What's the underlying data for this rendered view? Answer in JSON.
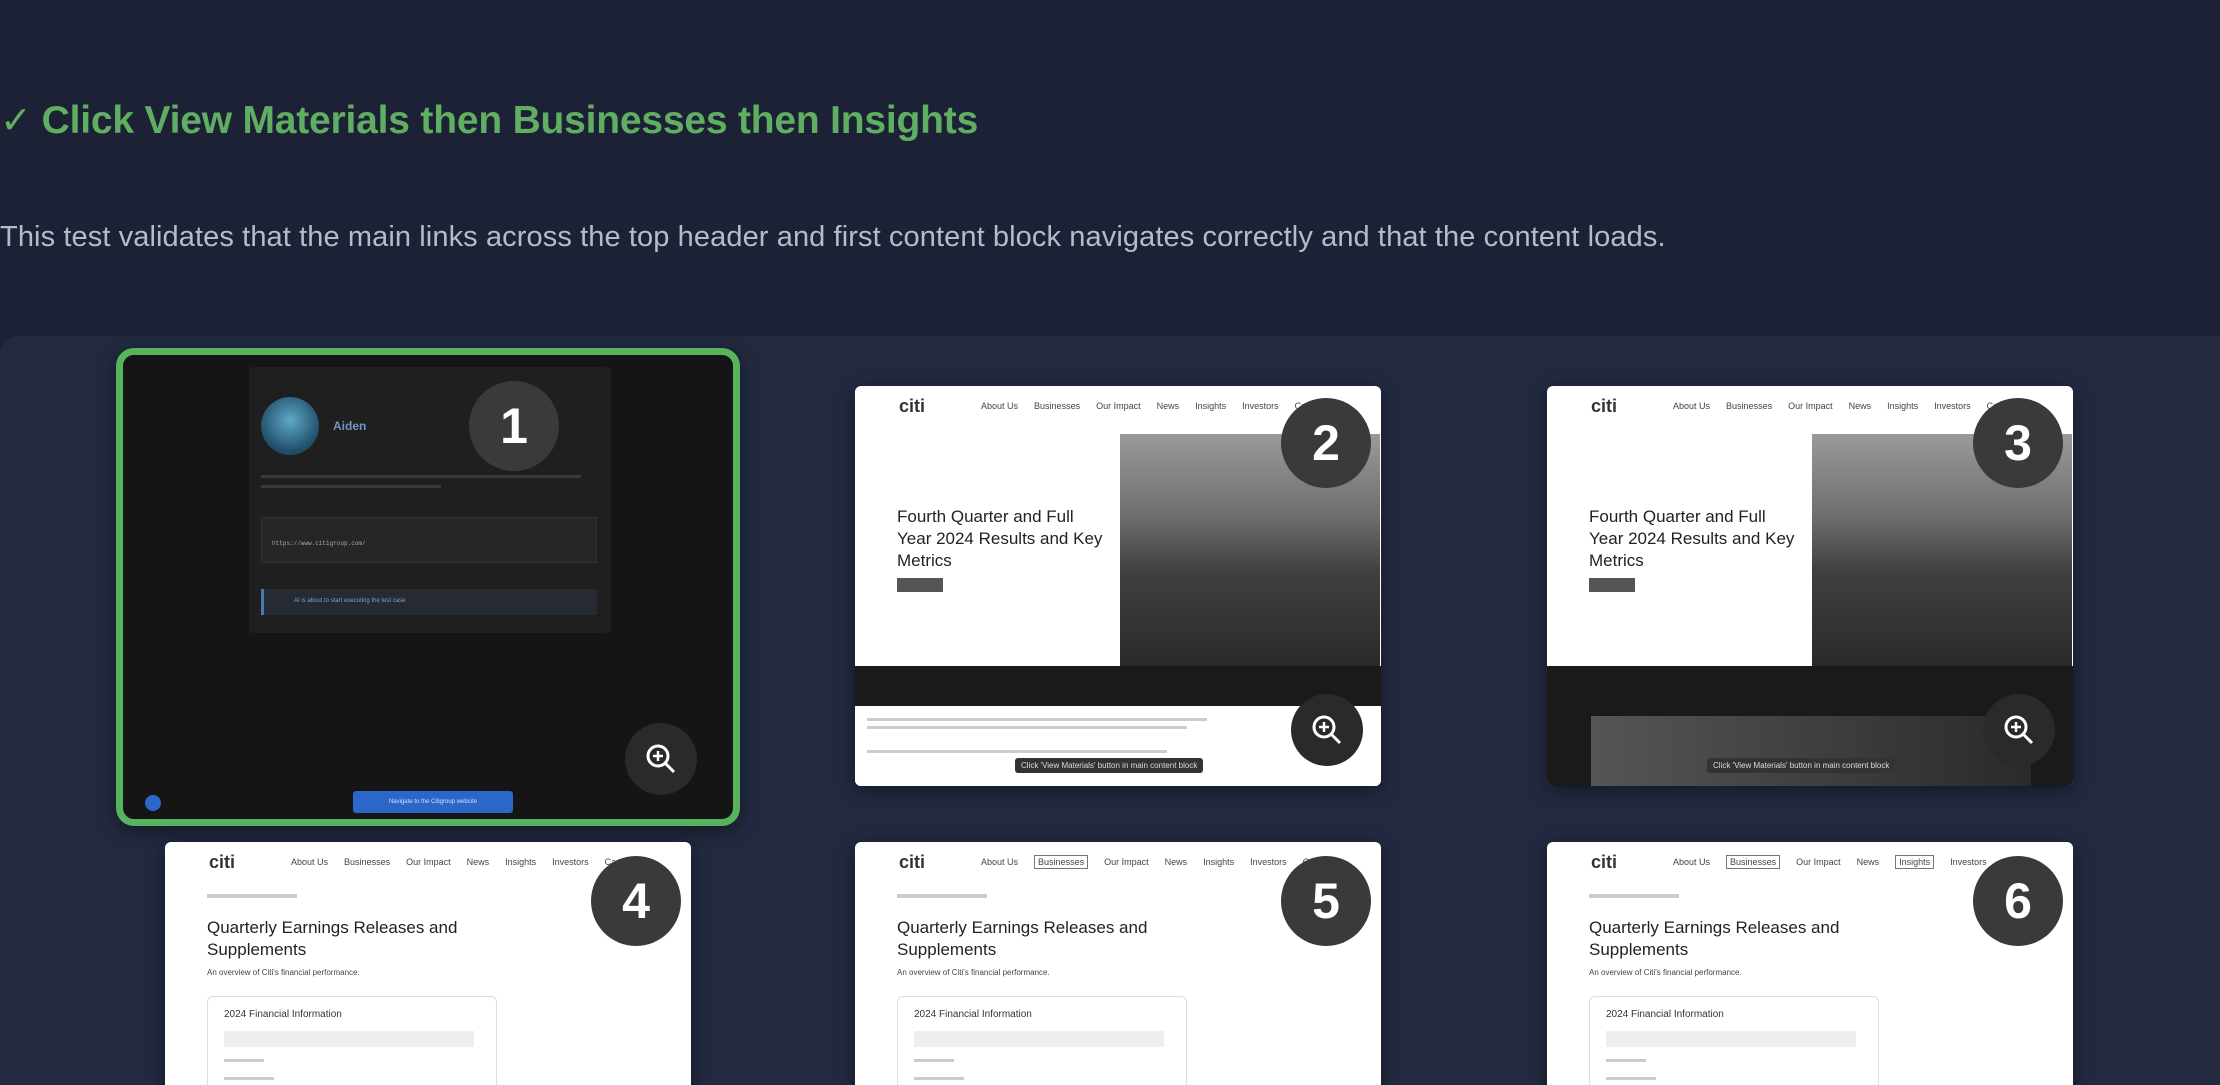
{
  "test": {
    "title": "Click View Materials then Businesses then Insights",
    "description": "This test validates that the main links across the top header and first content block navigates correctly and that the content loads."
  },
  "thumbs": [
    {
      "num": "1",
      "user": "Aiden",
      "url": "https://www.citigroup.com/",
      "notice": "AI is about to start executing the test case",
      "cta": "Navigate to the Citigroup website"
    },
    {
      "num": "2",
      "hero_title": "Fourth Quarter and Full Year 2024 Results and Key Metrics",
      "tooltip": "Click 'View Materials' button in main content block"
    },
    {
      "num": "3",
      "hero_title": "Fourth Quarter and Full Year 2024 Results and Key Metrics",
      "tooltip": "Click 'View Materials' button in main content block"
    },
    {
      "num": "4",
      "page_title": "Quarterly Earnings Releases and Supplements",
      "page_sub": "An overview of Citi's financial performance.",
      "card_title": "2024 Financial Information"
    },
    {
      "num": "5",
      "page_title": "Quarterly Earnings Releases and Supplements",
      "page_sub": "An overview of Citi's financial performance.",
      "card_title": "2024 Financial Information"
    },
    {
      "num": "6",
      "page_title": "Quarterly Earnings Releases and Supplements",
      "page_sub": "An overview of Citi's financial performance.",
      "card_title": "2024 Financial Information"
    }
  ],
  "nav": {
    "logo": "citi",
    "items": [
      "About Us",
      "Businesses",
      "Our Impact",
      "News",
      "Insights",
      "Investors",
      "Careers"
    ]
  },
  "colors": {
    "background": "#1c2136",
    "success": "#5fae62",
    "active_border": "#57b35d"
  },
  "icons": {
    "check": "check-icon",
    "zoom": "zoom-in-icon"
  }
}
